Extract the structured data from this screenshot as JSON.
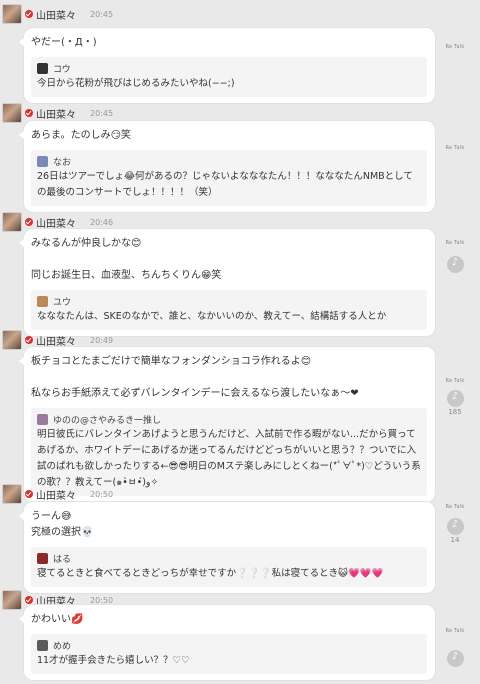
{
  "colors": {
    "background": "#e9e9e9",
    "bubble": "#ffffff",
    "quote": "#f4f4f4",
    "verified": "#d9302c"
  },
  "side_label": "Re Talk",
  "posts": [
    {
      "author": "山田菜々",
      "time": "20:45",
      "text": "やだー(・Д・)",
      "reply": {
        "user": "コウ",
        "text": "今日から花粉が飛びはじめるみたいやね(−−;)"
      },
      "count": ""
    },
    {
      "author": "山田菜々",
      "time": "20:45",
      "text": "あらま。たのしみ😏笑",
      "reply": {
        "user": "なお",
        "text": "26日はツアーでしょ😂何があるの？じゃないよなななたん！！！なななたんNMBとしての最後のコンサートでしょ！！！！（笑）"
      },
      "count": ""
    },
    {
      "author": "山田菜々",
      "time": "20:46",
      "text": "みなるんが仲良しかな😊\n\n同じお誕生日、血液型、ちんちくりん😁笑",
      "reply": {
        "user": "ユウ",
        "text": "なななたんは、SKEのなかで、誰と、なかいいのか、教えてー、結構話する人とか"
      },
      "count": ""
    },
    {
      "author": "山田菜々",
      "time": "20:49",
      "text": "板チョコとたまごだけで簡単なフォンダンショコラ作れるよ😊\n\n私ならお手紙添えて必ずバレンタインデーに会えるなら渡したいなぁ〜❤",
      "reply": {
        "user": "ゆのの@さやみるき一推し",
        "text": "明日彼氏にバレンタインあげようと思うんだけど、入試前で作る暇がない...だから買ってあげるか、ホワイトデーにあげるか迷ってるんだけどどっちがいいと思う？？ついでに入試のぱれも欲しかったりする←😎😎明日のMステ楽しみにしとくねー(*ﾟ∀ﾟ*)♡どういう系の歌？？教えてー(๑•̀ㅂ•́)و✧"
      },
      "count": "185"
    },
    {
      "author": "山田菜々",
      "time": "20:50",
      "text": "うーん😅\n究極の選択💀",
      "reply": {
        "user": "はる",
        "text": "寝てるときと食べてるときどっちが幸せですか❔❔❔私は寝てるとき😺💗💗💗"
      },
      "count": "14"
    },
    {
      "author": "山田菜々",
      "time": "20:50",
      "text": "かわいい💋",
      "reply": {
        "user": "めめ",
        "text": "11才が握手会きたら嬉しい？？♡♡"
      },
      "count": ""
    }
  ]
}
